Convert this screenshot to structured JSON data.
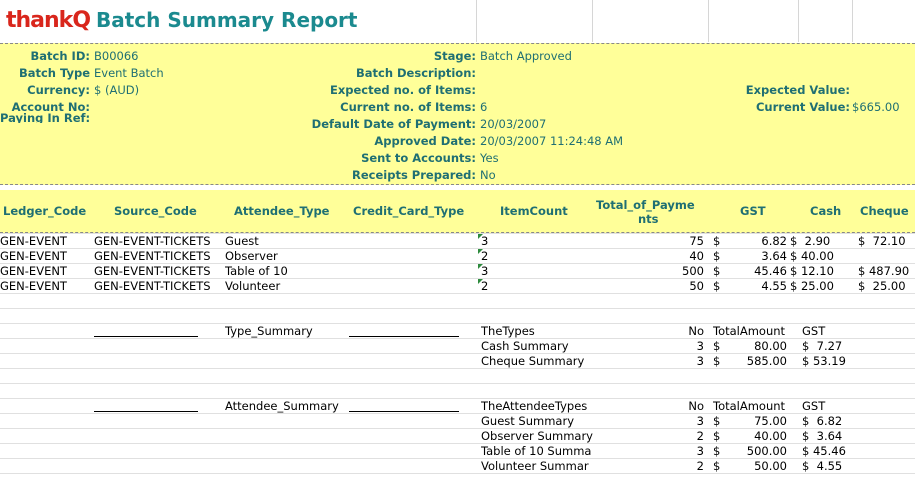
{
  "app": {
    "logo_text": "thankQ",
    "title": "Batch Summary Report"
  },
  "batch": {
    "left": [
      {
        "label": "Batch ID:",
        "value": "B00066"
      },
      {
        "label": "Batch Type",
        "value": "Event Batch"
      },
      {
        "label": "Currency:",
        "value": "$ (AUD)"
      },
      {
        "label": "Account No:",
        "value": ""
      },
      {
        "label": "Paying In Ref:",
        "value": ""
      }
    ],
    "middle": [
      {
        "label": "Stage:",
        "value": "Batch Approved"
      },
      {
        "label": "Batch Description:",
        "value": ""
      },
      {
        "label": "Expected no. of Items:",
        "value": ""
      },
      {
        "label": "Current no. of Items:",
        "value": "6"
      },
      {
        "label": "Default Date of Payment:",
        "value": "20/03/2007"
      },
      {
        "label": "Approved Date:",
        "value": "20/03/2007 11:24:48 AM"
      },
      {
        "label": "Sent to Accounts:",
        "value": "Yes"
      },
      {
        "label": "Receipts Prepared:",
        "value": "No"
      }
    ],
    "right": [
      {
        "label": "Expected Value:",
        "value": ""
      },
      {
        "label": "Current Value:",
        "value": "$665.00"
      }
    ]
  },
  "columns": {
    "ledger": "Ledger_Code",
    "source": "Source_Code",
    "attendee": "Attendee_Type",
    "card": "Credit_Card_Type",
    "count": "ItemCount",
    "total_1": "Total_of_Payme",
    "total_2": "nts",
    "gst": "GST",
    "cash": "Cash",
    "cheque": "Cheque"
  },
  "rows": [
    {
      "ledger": "GEN-EVENT",
      "source": "GEN-EVENT-TICKETS",
      "attendee": "Guest",
      "count": "3",
      "total": "75",
      "gst_sym": "$",
      "gst": "6.82",
      "cash": "$  2.90",
      "cheque": "$  72.10"
    },
    {
      "ledger": "GEN-EVENT",
      "source": "GEN-EVENT-TICKETS",
      "attendee": "Observer",
      "count": "2",
      "total": "40",
      "gst_sym": "$",
      "gst": "3.64",
      "cash": "$ 40.00",
      "cheque": ""
    },
    {
      "ledger": "GEN-EVENT",
      "source": "GEN-EVENT-TICKETS",
      "attendee": "Table of 10",
      "count": "3",
      "total": "500",
      "gst_sym": "$",
      "gst": "45.46",
      "cash": "$ 12.10",
      "cheque": "$ 487.90"
    },
    {
      "ledger": "GEN-EVENT",
      "source": "GEN-EVENT-TICKETS",
      "attendee": "Volunteer",
      "count": "2",
      "total": "50",
      "gst_sym": "$",
      "gst": "4.55",
      "cash": "$ 25.00",
      "cheque": "$  25.00"
    }
  ],
  "type_summary": {
    "label": "Type_Summary",
    "h_types": "TheTypes",
    "h_no": "No",
    "h_amount": "TotalAmount",
    "h_gst": "GST",
    "rows": [
      {
        "name": "Cash Summary",
        "no": "3",
        "sym": "$",
        "amount": "80.00",
        "gst": "$  7.27"
      },
      {
        "name": "Cheque Summary",
        "no": "3",
        "sym": "$",
        "amount": "585.00",
        "gst": "$ 53.19"
      }
    ]
  },
  "attendee_summary": {
    "label": "Attendee_Summary",
    "h_types": "TheAttendeeTypes",
    "h_no": "No",
    "h_amount": "TotalAmount",
    "h_gst": "GST",
    "rows": [
      {
        "name": "Guest Summary",
        "no": "3",
        "sym": "$",
        "amount": "75.00",
        "gst": "$  6.82"
      },
      {
        "name": "Observer Summary",
        "no": "2",
        "sym": "$",
        "amount": "40.00",
        "gst": "$  3.64"
      },
      {
        "name": "Table of 10 Summa",
        "no": "3",
        "sym": "$",
        "amount": "500.00",
        "gst": "$ 45.46"
      },
      {
        "name": "Volunteer Summar",
        "no": "2",
        "sym": "$",
        "amount": "50.00",
        "gst": "$  4.55"
      }
    ]
  }
}
